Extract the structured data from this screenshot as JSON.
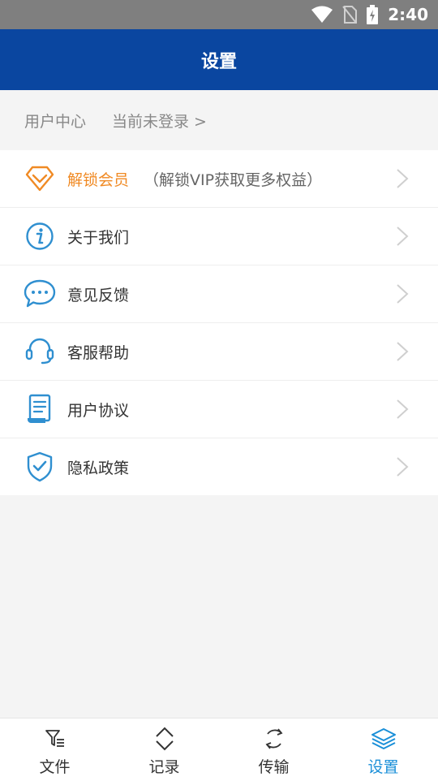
{
  "status_bar": {
    "time": "2:40"
  },
  "header": {
    "title": "设置"
  },
  "user_center": {
    "label": "用户中心",
    "status": "当前未登录 >"
  },
  "menu": [
    {
      "label": "解锁会员",
      "extra": "（解锁VIP获取更多权益）",
      "icon": "vip-diamond-icon"
    },
    {
      "label": "关于我们",
      "icon": "info-icon"
    },
    {
      "label": "意见反馈",
      "icon": "chat-bubble-icon"
    },
    {
      "label": "客服帮助",
      "icon": "headset-icon"
    },
    {
      "label": "用户协议",
      "icon": "document-icon"
    },
    {
      "label": "隐私政策",
      "icon": "shield-check-icon"
    }
  ],
  "bottom_nav": [
    {
      "label": "文件",
      "icon": "filter-list-icon"
    },
    {
      "label": "记录",
      "icon": "chevron-updown-icon"
    },
    {
      "label": "传输",
      "icon": "sync-icon"
    },
    {
      "label": "设置",
      "icon": "layers-icon",
      "active": true
    }
  ],
  "colors": {
    "header_bg": "#0a46a0",
    "vip_orange": "#f08a24",
    "icon_blue": "#2f8fd0",
    "active_tab": "#1a8fd8"
  }
}
